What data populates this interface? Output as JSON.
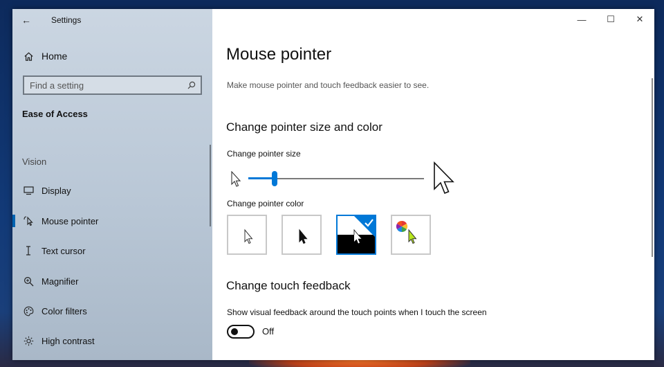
{
  "window": {
    "app_title": "Settings",
    "back_icon": "arrow-left-icon",
    "controls": {
      "minimize": "—",
      "maximize": "☐",
      "close": "✕"
    }
  },
  "sidebar": {
    "home_label": "Home",
    "search_placeholder": "Find a setting",
    "section_title": "Ease of Access",
    "group_label": "Vision",
    "items": [
      {
        "label": "Display",
        "icon": "monitor-icon",
        "active": false
      },
      {
        "label": "Mouse pointer",
        "icon": "mouse-pointer-icon",
        "active": true
      },
      {
        "label": "Text cursor",
        "icon": "text-cursor-icon",
        "active": false
      },
      {
        "label": "Magnifier",
        "icon": "magnifier-icon",
        "active": false
      },
      {
        "label": "Color filters",
        "icon": "color-palette-icon",
        "active": false
      },
      {
        "label": "High contrast",
        "icon": "sun-icon",
        "active": false
      }
    ]
  },
  "main": {
    "title": "Mouse pointer",
    "description": "Make mouse pointer and touch feedback easier to see.",
    "size_color_heading": "Change pointer size and color",
    "pointer_size_label": "Change pointer size",
    "pointer_size_value": 0.15,
    "pointer_color_label": "Change pointer color",
    "color_options": [
      {
        "name": "white",
        "selected": false
      },
      {
        "name": "black",
        "selected": false
      },
      {
        "name": "inverted",
        "selected": true
      },
      {
        "name": "custom",
        "selected": false
      }
    ],
    "touch_heading": "Change touch feedback",
    "touch_description": "Show visual feedback around the touch points when I touch the screen",
    "touch_toggle_state": "Off"
  },
  "colors": {
    "accent": "#0078d7"
  }
}
